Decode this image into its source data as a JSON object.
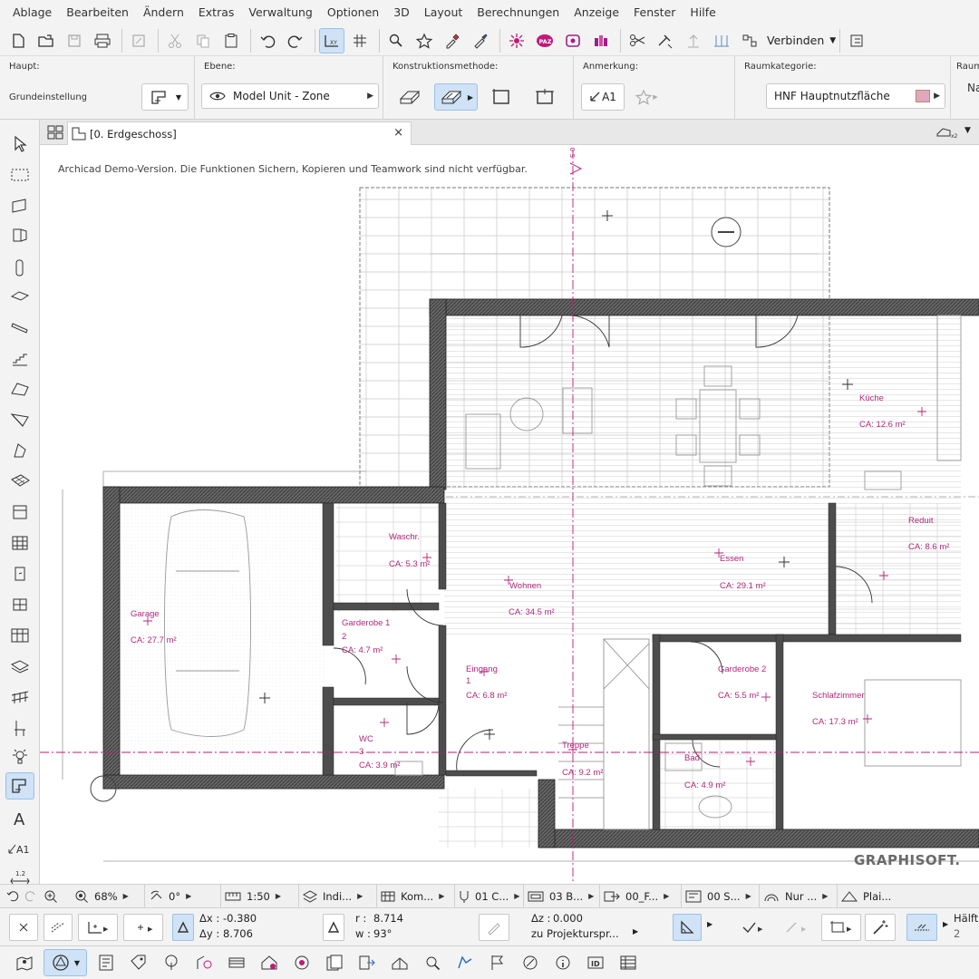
{
  "menu": [
    "Ablage",
    "Bearbeiten",
    "Ändern",
    "Extras",
    "Verwaltung",
    "Optionen",
    "3D",
    "Layout",
    "Berechnungen",
    "Anzeige",
    "Fenster",
    "Hilfe"
  ],
  "toolbar": {
    "verbinden_label": "Verbinden"
  },
  "infobox": {
    "haupt": {
      "title": "Haupt:",
      "value": "Grundeinstellung"
    },
    "ebene": {
      "title": "Ebene:",
      "value": "Model Unit - Zone"
    },
    "konstruktion": {
      "title": "Konstruktionsmethode:"
    },
    "anmerkung": {
      "title": "Anmerkung:",
      "label_button": "A1"
    },
    "raumkategorie": {
      "title": "Raumkategorie:",
      "value": "HNF  Hauptnutzfläche",
      "swatch": "#e0a8bd"
    },
    "cut": {
      "title": "Raum",
      "value": "Na"
    }
  },
  "tab": {
    "label": "[0. Erdgeschoss]",
    "close": "×"
  },
  "canvas": {
    "demo_notice": "Archicad Demo-Version. Die Funktionen Sichern, Kopieren und Teamwork sind nicht verfügbar.",
    "section_marker": "S-0",
    "logo": "GRAPHISOFT."
  },
  "zones": [
    {
      "name": "Garage",
      "area": "CA: 27.7 m²"
    },
    {
      "name": "Waschr.",
      "area": "CA: 5.3 m²"
    },
    {
      "name": "Garderobe 1",
      "num": "2",
      "area": "CA:   4.7 m²"
    },
    {
      "name": "WC",
      "num": "3",
      "area": "CA: 3.9 m²"
    },
    {
      "name": "Eingang",
      "num": "1",
      "area": "CA: 6.8 m²"
    },
    {
      "name": "Wohnen",
      "area": "CA: 34.5 m²"
    },
    {
      "name": "Essen",
      "area": "CA: 29.1 m²"
    },
    {
      "name": "Küche",
      "area": "CA: 12.6 m²"
    },
    {
      "name": "Reduit",
      "area": "CA: 8.6 m²"
    },
    {
      "name": "Treppe",
      "area": "CA: 9.2 m²"
    },
    {
      "name": "Garderobe 2",
      "area": "CA:     5.5 m²"
    },
    {
      "name": "Bad",
      "area": "CA: 4.9 m²"
    },
    {
      "name": "Schlafzimmer",
      "area": "CA:     17.3 m²"
    }
  ],
  "navbar": {
    "zoom": "68%",
    "angle": "0°",
    "scale": "1:50",
    "layer_combo": "Indi...",
    "pen_set": "Kom...",
    "model_view": "01 C...",
    "structure": "03 B...",
    "renovation": "00_F...",
    "dim": "00 S...",
    "filter": "Nur ...",
    "partial": "Plai..."
  },
  "coords": {
    "dx_label": "Δx :",
    "dx": "-0.380",
    "dy_label": "Δy :",
    "dy": "8.706",
    "r_label": "r :",
    "r": "8.714",
    "w_label": "w :",
    "w": "93°",
    "dz_label": "Δz :",
    "dz": "0.000",
    "ref": "zu Projekturspr...",
    "half_label": "Hälft",
    "half_value": "2"
  }
}
